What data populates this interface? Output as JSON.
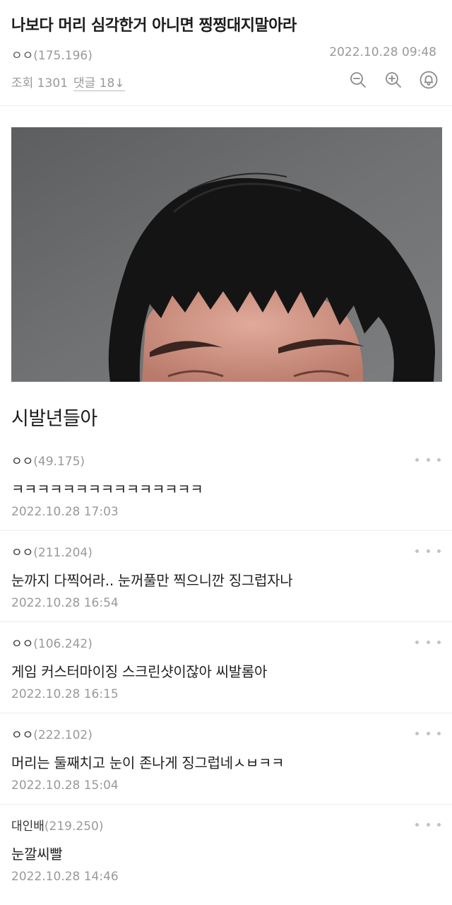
{
  "post": {
    "title": "나보다 머리 심각한거 아니면 찡찡대지말아라",
    "author_nick": "ㅇㅇ",
    "author_ip": "(175.196)",
    "date": "2022.10.28 09:48",
    "views_text": "조회 1301",
    "comments_link": "댓글 18↓",
    "body_text": "시발년들아",
    "image_subject": "cropped-photo-of-man-with-short-bangs"
  },
  "toolbar": {
    "icons": [
      "zoom-out-icon",
      "zoom-in-icon",
      "bell-icon"
    ]
  },
  "comments": [
    {
      "nick": "ㅇㅇ",
      "ip": "(49.175)",
      "text": "ㅋㅋㅋㅋㅋㅋㅋㅋㅋㅋㅋㅋㅋㅋㅋ",
      "date": "2022.10.28 17:03"
    },
    {
      "nick": "ㅇㅇ",
      "ip": "(211.204)",
      "text": "눈까지 다찍어라.. 눈꺼풀만 찍으니깐 징그럽자나",
      "date": "2022.10.28 16:54"
    },
    {
      "nick": "ㅇㅇ",
      "ip": "(106.242)",
      "text": "게임 커스터마이징 스크린샷이잖아 씨발롬아",
      "date": "2022.10.28 16:15"
    },
    {
      "nick": "ㅇㅇ",
      "ip": "(222.102)",
      "text": "머리는 둘째치고 눈이 존나게 징그럽네ㅅㅂㅋㅋ",
      "date": "2022.10.28 15:04"
    },
    {
      "nick": "대인배",
      "ip": "(219.250)",
      "text": "눈깔씨빨",
      "date": "2022.10.28 14:46"
    }
  ],
  "colors": {
    "text": "#222222",
    "meta": "#999999",
    "divider": "#ececec",
    "icon": "#8a8a8a"
  }
}
